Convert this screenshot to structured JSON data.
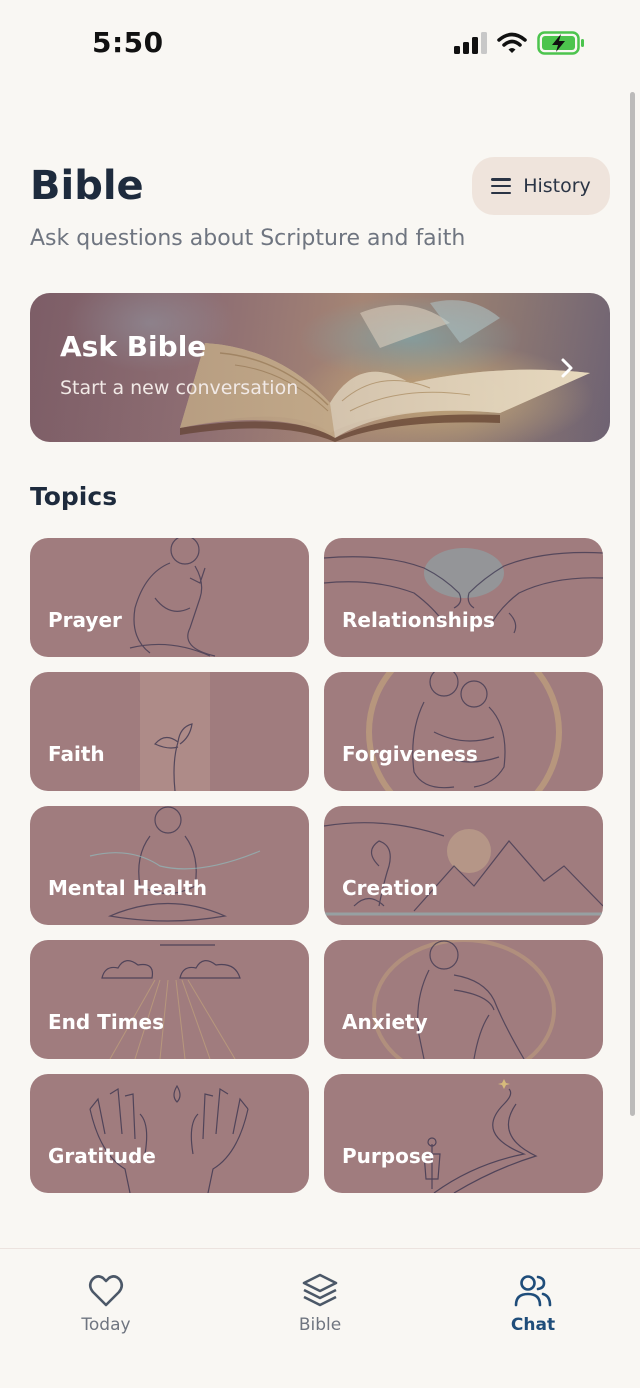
{
  "status_bar": {
    "time": "5:50"
  },
  "header": {
    "title": "Bible",
    "subtitle": "Ask questions about Scripture and faith",
    "history_label": "History"
  },
  "ask_card": {
    "title": "Ask Bible",
    "subtitle": "Start a new conversation"
  },
  "topics": {
    "heading": "Topics",
    "items": [
      {
        "label": "Prayer"
      },
      {
        "label": "Relationships"
      },
      {
        "label": "Faith"
      },
      {
        "label": "Forgiveness"
      },
      {
        "label": "Mental Health"
      },
      {
        "label": "Creation"
      },
      {
        "label": "End Times"
      },
      {
        "label": "Anxiety"
      },
      {
        "label": "Gratitude"
      },
      {
        "label": "Purpose"
      }
    ]
  },
  "bottom_nav": {
    "items": [
      {
        "label": "Today",
        "icon": "heart-icon",
        "active": false
      },
      {
        "label": "Bible",
        "icon": "layers-icon",
        "active": false
      },
      {
        "label": "Chat",
        "icon": "users-icon",
        "active": true
      }
    ]
  },
  "colors": {
    "background": "#f9f7f3",
    "tile": "#a07c7e",
    "history_button": "#efe4dc",
    "active_nav": "#1f4d7a",
    "battery": "#4cc44d"
  }
}
